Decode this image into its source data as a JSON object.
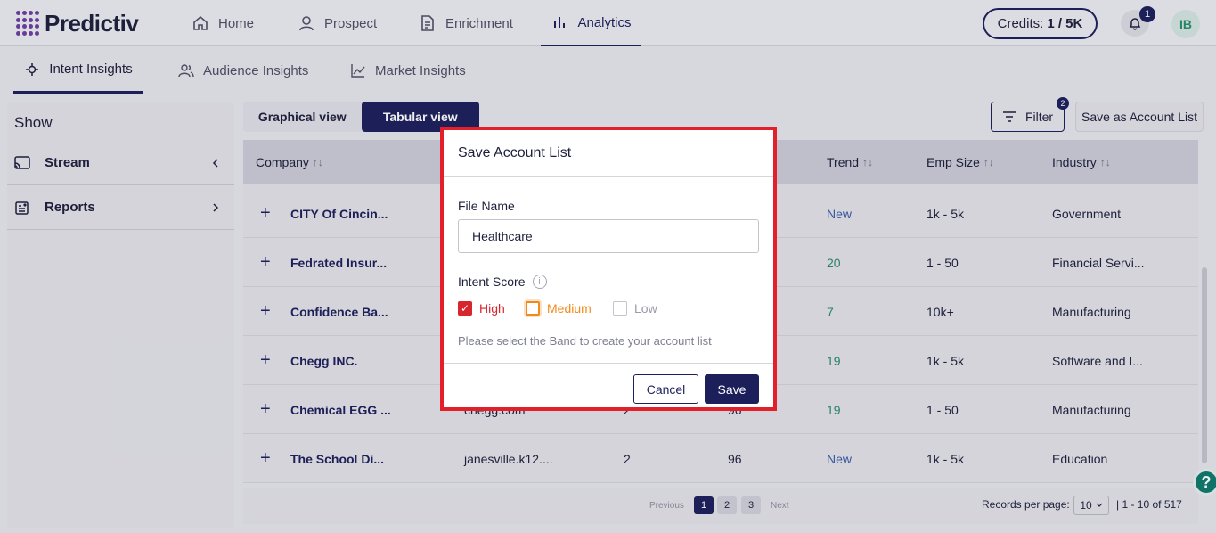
{
  "app": {
    "brand": "Predictiv"
  },
  "nav": {
    "items": [
      {
        "label": "Home",
        "icon": "home-icon"
      },
      {
        "label": "Prospect",
        "icon": "user-icon"
      },
      {
        "label": "Enrichment",
        "icon": "document-icon"
      },
      {
        "label": "Analytics",
        "icon": "bar-chart-icon",
        "active": true
      }
    ],
    "credits_label": "Credits:",
    "credits_value": "1 / 5K",
    "notification_count": "1",
    "avatar_initials": "IB"
  },
  "subtabs": [
    {
      "label": "Intent Insights",
      "active": true
    },
    {
      "label": "Audience Insights"
    },
    {
      "label": "Market Insights"
    }
  ],
  "sidebar": {
    "heading": "Show",
    "items": [
      {
        "label": "Stream",
        "chevron": "left"
      },
      {
        "label": "Reports",
        "chevron": "right"
      }
    ]
  },
  "toolbar": {
    "graphical_view": "Graphical view",
    "tabular_view": "Tabular view",
    "filter_label": "Filter",
    "filter_count": "2",
    "save_account_list": "Save as Account List"
  },
  "table": {
    "headers": {
      "company": "Company",
      "trend": "Trend",
      "emp_size": "Emp Size",
      "industry": "Industry"
    },
    "rows": [
      {
        "company": "CITY Of Cincin...",
        "domain": "",
        "c3": "",
        "c4": "",
        "trend": "New",
        "emp": "1k - 5k",
        "industry": "Government"
      },
      {
        "company": "Fedrated Insur...",
        "domain": "",
        "c3": "",
        "c4": "",
        "trend": "20",
        "emp": "1 - 50",
        "industry": "Financial Servi..."
      },
      {
        "company": "Confidence Ba...",
        "domain": "",
        "c3": "",
        "c4": "",
        "trend": "7",
        "emp": "10k+",
        "industry": "Manufacturing"
      },
      {
        "company": "Chegg INC.",
        "domain": "",
        "c3": "",
        "c4": "",
        "trend": "19",
        "emp": "1k - 5k",
        "industry": "Software and I..."
      },
      {
        "company": "Chemical EGG ...",
        "domain": "chegg.com",
        "c3": "2",
        "c4": "96",
        "trend": "19",
        "emp": "1 - 50",
        "industry": "Manufacturing"
      },
      {
        "company": "The School Di...",
        "domain": "janesville.k12....",
        "c3": "2",
        "c4": "96",
        "trend": "New",
        "emp": "1k - 5k",
        "industry": "Education"
      }
    ]
  },
  "pagination": {
    "previous": "Previous",
    "pages": [
      "1",
      "2",
      "3"
    ],
    "next": "Next",
    "records_per_page_label": "Records per page:",
    "records_per_page_value": "10",
    "records_range": "| 1 - 10 of 517"
  },
  "modal": {
    "title": "Save Account List",
    "file_name_label": "File Name",
    "file_name_value": "Healthcare",
    "intent_score_label": "Intent Score",
    "bands": [
      {
        "label": "High",
        "checked": true,
        "color": "#d8262e"
      },
      {
        "label": "Medium",
        "checked": false,
        "color": "#f08a1a"
      },
      {
        "label": "Low",
        "checked": false,
        "color": "#9a9ca8"
      }
    ],
    "hint": "Please select the Band to create your account list",
    "cancel": "Cancel",
    "save": "Save"
  },
  "colors": {
    "primary": "#1d1f5b",
    "danger": "#e3202a",
    "accent_green": "#2a8a6a"
  }
}
